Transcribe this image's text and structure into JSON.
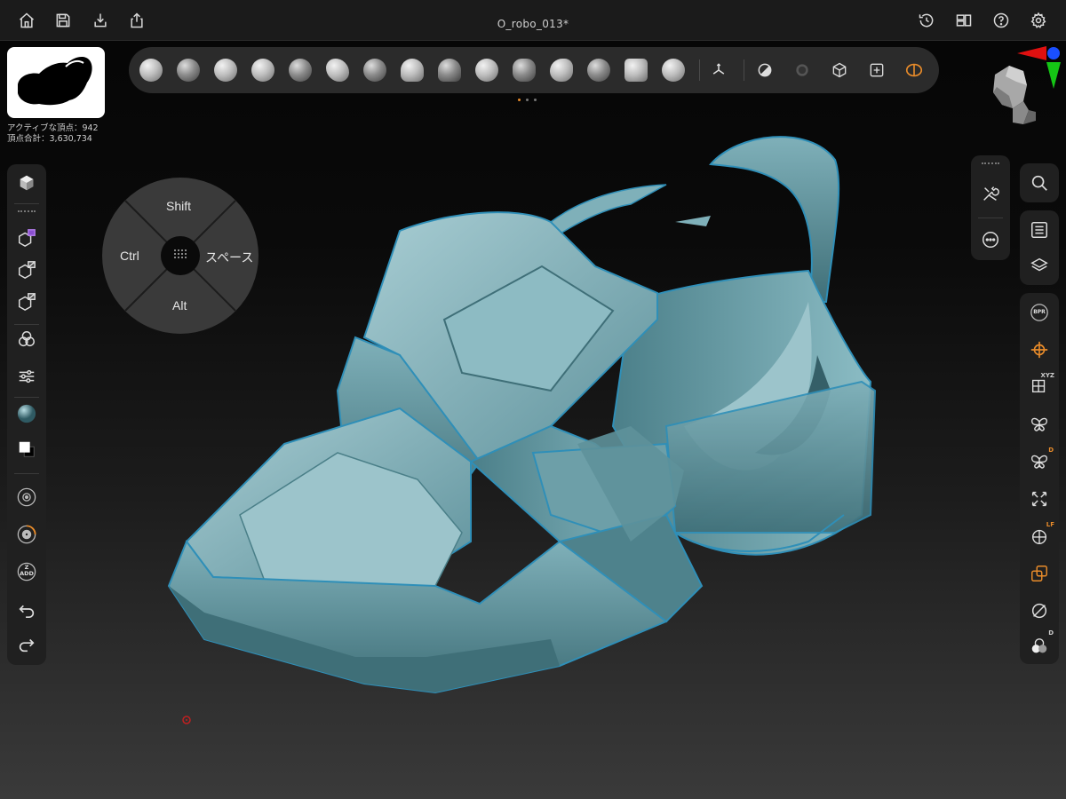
{
  "app": {
    "document_title": "O_robo_013*"
  },
  "topbar": {
    "left_icons": [
      "home-icon",
      "save-icon",
      "import-icon",
      "share-icon"
    ],
    "right_icons": [
      "history-icon",
      "layout-icon",
      "help-icon",
      "settings-icon"
    ]
  },
  "stats": {
    "active_vertices": "アクティブな頂点：942",
    "total_vertices": "頂点合計：3,630,734"
  },
  "brushbar": {
    "brush_count": 15,
    "pages": 3,
    "current_page": 1,
    "accent_color": "#e88b2a"
  },
  "radial_menu": {
    "top": "Shift",
    "left": "Ctrl",
    "right": "スペース",
    "bottom": "Alt"
  },
  "left_toolbar": {
    "zadd_label": "Z\nADD"
  },
  "right_toolbar": {
    "bpr_label": "BPR",
    "xyz_badge": "XYZ",
    "d_badge": "D",
    "lf_badge": "LF",
    "d2_badge": "D"
  },
  "colors": {
    "model_base": "#6aa0aa",
    "model_light": "#9cc4cb",
    "model_dark": "#3f6f78",
    "model_rim": "#2f8fb8",
    "accent": "#e88b2a"
  }
}
